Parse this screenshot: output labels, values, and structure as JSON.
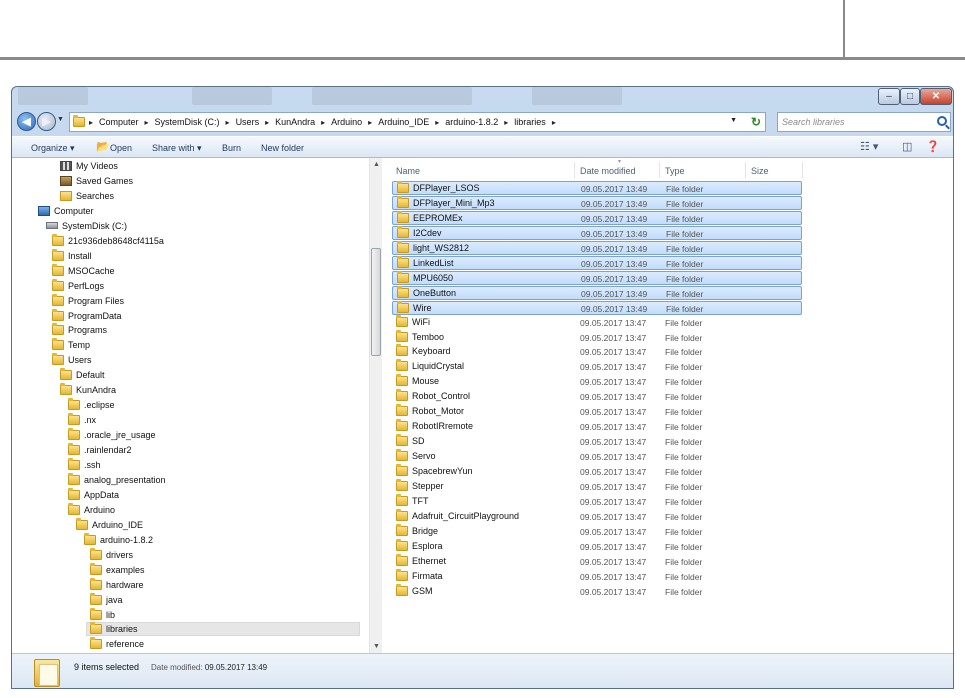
{
  "address": {
    "crumbs": [
      "Computer",
      "SystemDisk (C:)",
      "Users",
      "KunAndra",
      "Arduino",
      "Arduino_IDE",
      "arduino-1.8.2",
      "libraries"
    ]
  },
  "search": {
    "placeholder": "Search libraries"
  },
  "toolbar": {
    "organize": "Organize ▾",
    "open": "Open",
    "share": "Share with ▾",
    "burn": "Burn",
    "new_folder": "New folder"
  },
  "nav": {
    "items": [
      {
        "label": "My Videos",
        "icon": "video"
      },
      {
        "label": "Saved Games",
        "icon": "games"
      },
      {
        "label": "Searches",
        "icon": "search-folder"
      },
      {
        "label": "Computer",
        "icon": "computer"
      },
      {
        "label": "SystemDisk (C:)",
        "icon": "drive"
      },
      {
        "label": "21c936deb8648cf4115a",
        "icon": "folder"
      },
      {
        "label": "Install",
        "icon": "folder"
      },
      {
        "label": "MSOCache",
        "icon": "folder"
      },
      {
        "label": "PerfLogs",
        "icon": "folder"
      },
      {
        "label": "Program Files",
        "icon": "folder"
      },
      {
        "label": "ProgramData",
        "icon": "folder"
      },
      {
        "label": "Programs",
        "icon": "folder"
      },
      {
        "label": "Temp",
        "icon": "folder"
      },
      {
        "label": "Users",
        "icon": "folder"
      },
      {
        "label": "Default",
        "icon": "folder"
      },
      {
        "label": "KunAndra",
        "icon": "folder"
      },
      {
        "label": ".eclipse",
        "icon": "folder"
      },
      {
        "label": ".nx",
        "icon": "folder"
      },
      {
        "label": ".oracle_jre_usage",
        "icon": "folder"
      },
      {
        "label": ".rainlendar2",
        "icon": "folder"
      },
      {
        "label": ".ssh",
        "icon": "folder"
      },
      {
        "label": "analog_presentation",
        "icon": "folder"
      },
      {
        "label": "AppData",
        "icon": "folder"
      },
      {
        "label": "Arduino",
        "icon": "folder"
      },
      {
        "label": "Arduino_IDE",
        "icon": "folder"
      },
      {
        "label": "arduino-1.8.2",
        "icon": "folder"
      },
      {
        "label": "drivers",
        "icon": "folder"
      },
      {
        "label": "examples",
        "icon": "folder"
      },
      {
        "label": "hardware",
        "icon": "folder"
      },
      {
        "label": "java",
        "icon": "folder"
      },
      {
        "label": "lib",
        "icon": "folder"
      },
      {
        "label": "libraries",
        "icon": "folder",
        "selected": true
      },
      {
        "label": "reference",
        "icon": "folder"
      }
    ]
  },
  "columns": {
    "name": "Name",
    "date": "Date modified",
    "type": "Type",
    "size": "Size"
  },
  "files": [
    {
      "name": "DFPlayer_LSOS",
      "date": "09.05.2017 13:49",
      "type": "File folder",
      "selected": true
    },
    {
      "name": "DFPlayer_Mini_Mp3",
      "date": "09.05.2017 13:49",
      "type": "File folder",
      "selected": true
    },
    {
      "name": "EEPROMEx",
      "date": "09.05.2017 13:49",
      "type": "File folder",
      "selected": true
    },
    {
      "name": "I2Cdev",
      "date": "09.05.2017 13:49",
      "type": "File folder",
      "selected": true
    },
    {
      "name": "light_WS2812",
      "date": "09.05.2017 13:49",
      "type": "File folder",
      "selected": true
    },
    {
      "name": "LinkedList",
      "date": "09.05.2017 13:49",
      "type": "File folder",
      "selected": true
    },
    {
      "name": "MPU6050",
      "date": "09.05.2017 13:49",
      "type": "File folder",
      "selected": true
    },
    {
      "name": "OneButton",
      "date": "09.05.2017 13:49",
      "type": "File folder",
      "selected": true
    },
    {
      "name": "Wire",
      "date": "09.05.2017 13:49",
      "type": "File folder",
      "selected": true
    },
    {
      "name": "WiFi",
      "date": "09.05.2017 13:47",
      "type": "File folder"
    },
    {
      "name": "Temboo",
      "date": "09.05.2017 13:47",
      "type": "File folder"
    },
    {
      "name": "Keyboard",
      "date": "09.05.2017 13:47",
      "type": "File folder"
    },
    {
      "name": "LiquidCrystal",
      "date": "09.05.2017 13:47",
      "type": "File folder"
    },
    {
      "name": "Mouse",
      "date": "09.05.2017 13:47",
      "type": "File folder"
    },
    {
      "name": "Robot_Control",
      "date": "09.05.2017 13:47",
      "type": "File folder"
    },
    {
      "name": "Robot_Motor",
      "date": "09.05.2017 13:47",
      "type": "File folder"
    },
    {
      "name": "RobotIRremote",
      "date": "09.05.2017 13:47",
      "type": "File folder"
    },
    {
      "name": "SD",
      "date": "09.05.2017 13:47",
      "type": "File folder"
    },
    {
      "name": "Servo",
      "date": "09.05.2017 13:47",
      "type": "File folder"
    },
    {
      "name": "SpacebrewYun",
      "date": "09.05.2017 13:47",
      "type": "File folder"
    },
    {
      "name": "Stepper",
      "date": "09.05.2017 13:47",
      "type": "File folder"
    },
    {
      "name": "TFT",
      "date": "09.05.2017 13:47",
      "type": "File folder"
    },
    {
      "name": "Adafruit_CircuitPlayground",
      "date": "09.05.2017 13:47",
      "type": "File folder"
    },
    {
      "name": "Bridge",
      "date": "09.05.2017 13:47",
      "type": "File folder"
    },
    {
      "name": "Esplora",
      "date": "09.05.2017 13:47",
      "type": "File folder"
    },
    {
      "name": "Ethernet",
      "date": "09.05.2017 13:47",
      "type": "File folder"
    },
    {
      "name": "Firmata",
      "date": "09.05.2017 13:47",
      "type": "File folder"
    },
    {
      "name": "GSM",
      "date": "09.05.2017 13:47",
      "type": "File folder"
    }
  ],
  "status": {
    "selection": "9 items selected",
    "date_label": "Date modified:",
    "date_value": "09.05.2017 13:49"
  }
}
